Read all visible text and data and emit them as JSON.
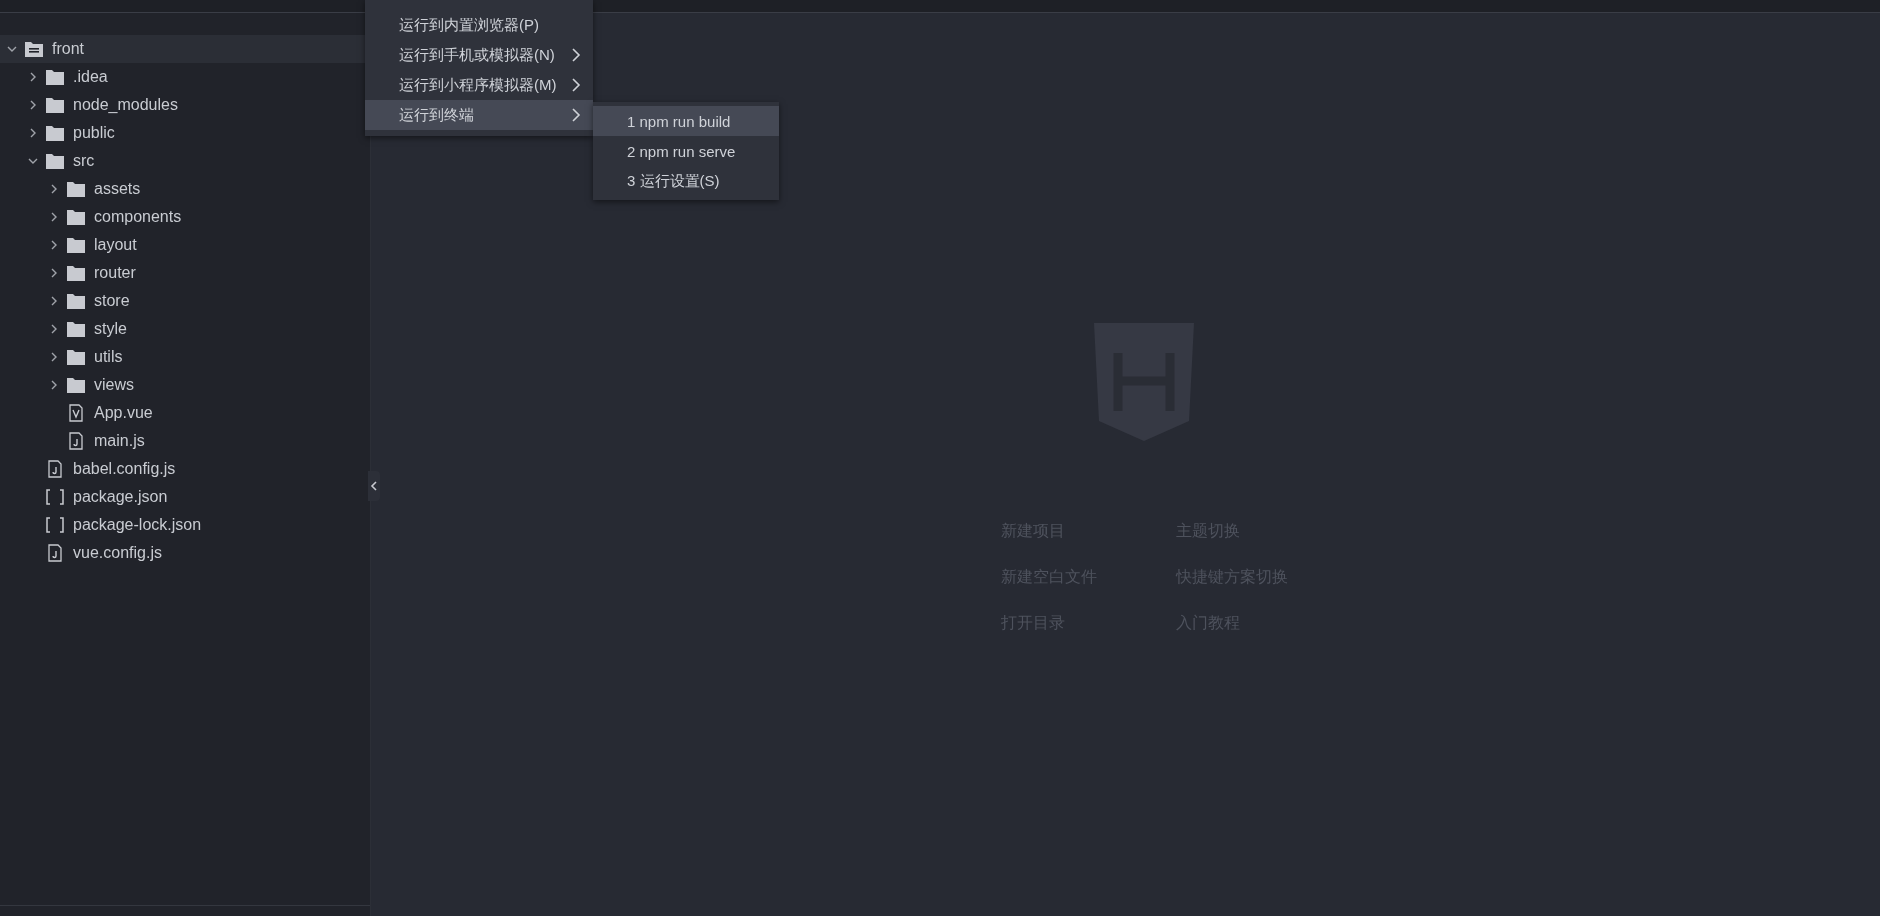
{
  "tree": [
    {
      "name": "front",
      "kind": "root",
      "expanded": true,
      "selected": true,
      "children": [
        {
          "name": ".idea",
          "kind": "folder",
          "expanded": false,
          "selected": false
        },
        {
          "name": "node_modules",
          "kind": "folder",
          "expanded": false,
          "selected": false
        },
        {
          "name": "public",
          "kind": "folder",
          "expanded": false,
          "selected": false
        },
        {
          "name": "src",
          "kind": "folder",
          "expanded": true,
          "selected": false,
          "children": [
            {
              "name": "assets",
              "kind": "folder",
              "expanded": false,
              "selected": false
            },
            {
              "name": "components",
              "kind": "folder",
              "expanded": false,
              "selected": false
            },
            {
              "name": "layout",
              "kind": "folder",
              "expanded": false,
              "selected": false
            },
            {
              "name": "router",
              "kind": "folder",
              "expanded": false,
              "selected": false
            },
            {
              "name": "store",
              "kind": "folder",
              "expanded": false,
              "selected": false
            },
            {
              "name": "style",
              "kind": "folder",
              "expanded": false,
              "selected": false
            },
            {
              "name": "utils",
              "kind": "folder",
              "expanded": false,
              "selected": false
            },
            {
              "name": "views",
              "kind": "folder",
              "expanded": false,
              "selected": false
            },
            {
              "name": "App.vue",
              "kind": "vue",
              "selected": false
            },
            {
              "name": "main.js",
              "kind": "js",
              "selected": false
            }
          ]
        },
        {
          "name": "babel.config.js",
          "kind": "js",
          "selected": false
        },
        {
          "name": "package.json",
          "kind": "json",
          "selected": false
        },
        {
          "name": "package-lock.json",
          "kind": "json",
          "selected": false
        },
        {
          "name": "vue.config.js",
          "kind": "js",
          "selected": false
        }
      ]
    }
  ],
  "run_menu": [
    {
      "label": "运行到内置浏览器(P)",
      "has_submenu": false,
      "selected": false
    },
    {
      "label": "运行到手机或模拟器(N)",
      "has_submenu": true,
      "selected": false
    },
    {
      "label": "运行到小程序模拟器(M)",
      "has_submenu": true,
      "selected": false
    },
    {
      "label": "运行到终端",
      "has_submenu": true,
      "selected": true
    }
  ],
  "terminal_submenu": [
    {
      "label": "1 npm run build",
      "selected": true
    },
    {
      "label": "2 npm run serve",
      "selected": false
    },
    {
      "label": "3 运行设置(S)",
      "selected": false
    }
  ],
  "welcome_links": [
    [
      "新建项目",
      "新建空白文件",
      "打开目录"
    ],
    [
      "主题切换",
      "快捷键方案切换",
      "入门教程"
    ]
  ]
}
